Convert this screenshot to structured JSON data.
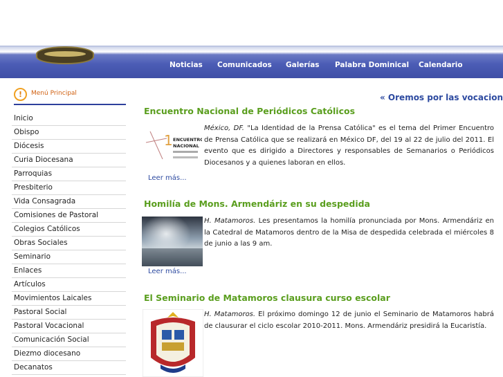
{
  "nav": {
    "items": [
      "Noticias",
      "Comunicados",
      "Galerías",
      "Palabra Dominical",
      "Calendario"
    ]
  },
  "menu": {
    "title": "Menú Principal",
    "icon": "exclamation-icon",
    "items": [
      "Inicio",
      "Obispo",
      "Diócesis",
      "Curia Diocesana",
      "Parroquias",
      "Presbiterio",
      "Vida Consagrada",
      "Comisiones de Pastoral",
      "Colegios Católicos",
      "Obras Sociales",
      "Seminario",
      "Enlaces",
      "Artículos",
      "Movimientos Laicales",
      "Pastoral Social",
      "Pastoral Vocacional",
      "Comunicación Social",
      "Diezmo diocesano",
      "Decanatos"
    ]
  },
  "marquee": "« Oremos por las vocacione",
  "articles": [
    {
      "title": "Encuentro Nacional de Periódicos Católicos",
      "place": "México, DF.",
      "text": " \"La Identidad de la Prensa Católica\" es el tema del Primer Encuentro de Prensa Católica que se realizará en México DF, del 19 al 22 de julio del 2011. El evento que es dirigido a Directores y responsables de Semanarios o Periódicos Diocesanos y a quienes laboran en ellos.",
      "readmore": "Leer más...",
      "thumb_lines": [
        "ENCUENTRO",
        "NACIONAL"
      ],
      "thumb_number": "1"
    },
    {
      "title": "Homilía de Mons. Armendáriz en su despedida",
      "place": "H. Matamoros.",
      "text": " Les presentamos la homilía pronunciada por Mons. Armendáriz en la Catedral de Matamoros dentro de la Misa de despedida celebrada el miércoles 8 de junio a las 9 am.",
      "readmore": "Leer más..."
    },
    {
      "title": "El Seminario de Matamoros clausura curso escolar",
      "place": "H. Matamoros.",
      "text": " El próximo domingo 12 de junio el Seminario de Matamoros habrá de clausurar el ciclo escolar 2010-2011. Mons. Armendáriz presidirá la Eucaristía."
    }
  ]
}
